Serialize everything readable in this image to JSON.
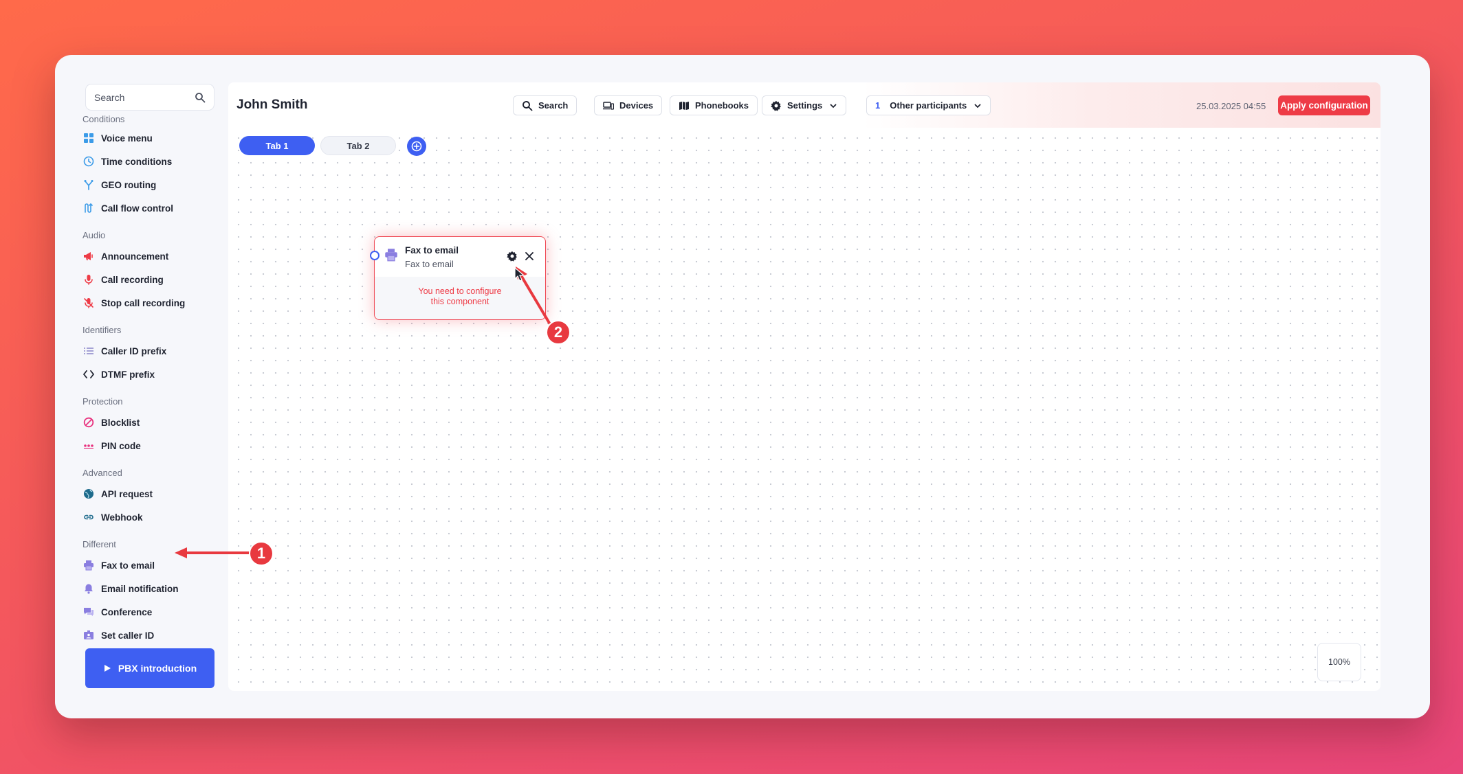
{
  "sidebar": {
    "search_placeholder": "Search",
    "groups": [
      {
        "label": "Conditions",
        "items": [
          {
            "label": "Voice menu",
            "icon": "grid-icon"
          },
          {
            "label": "Time conditions",
            "icon": "clock-icon"
          },
          {
            "label": "GEO routing",
            "icon": "fork-icon"
          },
          {
            "label": "Call flow control",
            "icon": "flow-icon"
          }
        ]
      },
      {
        "label": "Audio",
        "items": [
          {
            "label": "Announcement",
            "icon": "megaphone-icon"
          },
          {
            "label": "Call recording",
            "icon": "microphone-icon"
          },
          {
            "label": "Stop call recording",
            "icon": "microphone-off-icon"
          }
        ]
      },
      {
        "label": "Identifiers",
        "items": [
          {
            "label": "Caller ID prefix",
            "icon": "list-icon"
          },
          {
            "label": "DTMF prefix",
            "icon": "code-icon"
          }
        ]
      },
      {
        "label": "Protection",
        "items": [
          {
            "label": "Blocklist",
            "icon": "block-icon"
          },
          {
            "label": "PIN code",
            "icon": "pin-dots-icon"
          }
        ]
      },
      {
        "label": "Advanced",
        "items": [
          {
            "label": "API request",
            "icon": "globe-icon"
          },
          {
            "label": "Webhook",
            "icon": "link-icon"
          }
        ]
      },
      {
        "label": "Different",
        "items": [
          {
            "label": "Fax to email",
            "icon": "printer-icon"
          },
          {
            "label": "Email notification",
            "icon": "bell-icon"
          },
          {
            "label": "Conference",
            "icon": "chat-icon"
          },
          {
            "label": "Set caller ID",
            "icon": "id-badge-icon"
          }
        ]
      }
    ],
    "pbx_button": "PBX introduction"
  },
  "topbar": {
    "user_name": "John Smith",
    "search_label": "Search",
    "devices_label": "Devices",
    "phonebooks_label": "Phonebooks",
    "settings_label": "Settings",
    "participants_count": "1",
    "participants_label": "Other participants",
    "datetime": "25.03.2025 04:55",
    "apply_label": "Apply configuration"
  },
  "tabs": [
    {
      "label": "Tab 1"
    },
    {
      "label": "Tab 2"
    }
  ],
  "node": {
    "title": "Fax to email",
    "subtitle": "Fax to email",
    "warning_line1": "You need to configure",
    "warning_line2": "this component"
  },
  "zoom_level": "100%",
  "annotations": [
    {
      "number": "1"
    },
    {
      "number": "2"
    }
  ],
  "colors": {
    "accent": "#3e5ff2",
    "danger": "#ee3b46"
  }
}
